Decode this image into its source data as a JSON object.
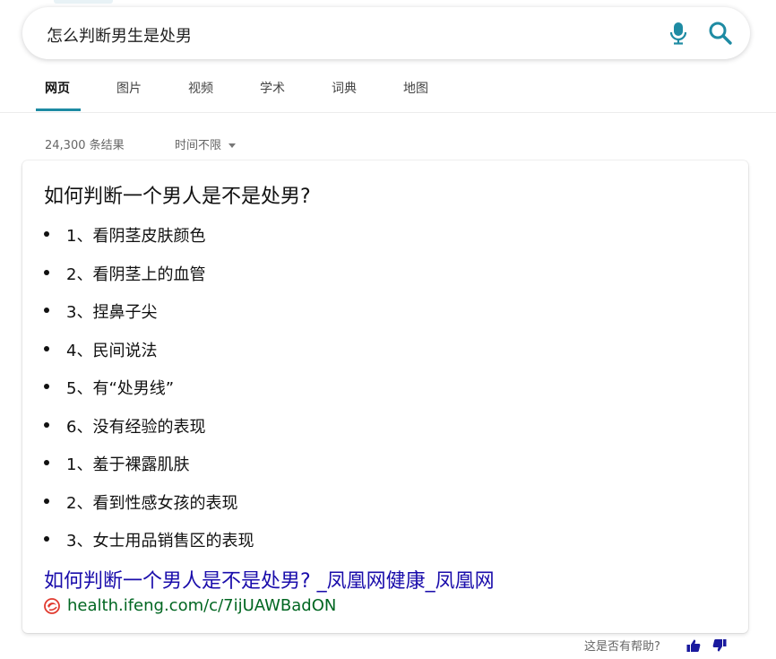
{
  "search": {
    "query": "怎么判断男生是处男"
  },
  "tabs": [
    {
      "label": "网页"
    },
    {
      "label": "图片"
    },
    {
      "label": "视频"
    },
    {
      "label": "学术"
    },
    {
      "label": "词典"
    },
    {
      "label": "地图"
    }
  ],
  "results_meta": {
    "count": "24,300 条结果",
    "time_filter": "时间不限"
  },
  "answer_card": {
    "title": "如何判断一个男人是不是处男?",
    "items": [
      "1、看阴茎皮肤颜色",
      "2、看阴茎上的血管",
      "3、捏鼻子尖",
      "4、民间说法",
      "5、有“处男线”",
      "6、没有经验的表现",
      "1、羞于裸露肌肤",
      "2、看到性感女孩的表现",
      "3、女士用品销售区的表现"
    ],
    "link_title": "如何判断一个男人是不是处男? _凤凰网健康_凤凰网",
    "link_url": "health.ifeng.com/c/7ijUAWBadON"
  },
  "feedback": {
    "label": "这是否有帮助?"
  },
  "colors": {
    "accent": "#1e8ba3",
    "link": "#1a0dab",
    "url": "#006621",
    "thumb": "#1a1a9e"
  }
}
